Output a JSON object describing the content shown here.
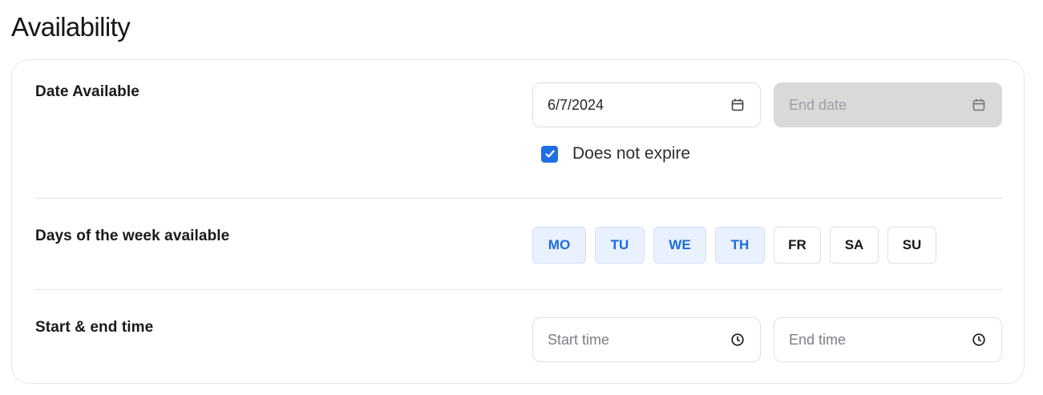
{
  "page": {
    "title": "Availability"
  },
  "date_row": {
    "label": "Date Available",
    "start_date": {
      "value": "6/7/2024",
      "icon": "calendar-icon"
    },
    "end_date": {
      "placeholder": "End date",
      "icon": "calendar-icon",
      "disabled": true
    },
    "does_not_expire": {
      "label": "Does not expire",
      "checked": true
    }
  },
  "days_row": {
    "label": "Days of the week available",
    "days": [
      {
        "label": "MO",
        "selected": true
      },
      {
        "label": "TU",
        "selected": true
      },
      {
        "label": "WE",
        "selected": true
      },
      {
        "label": "TH",
        "selected": true
      },
      {
        "label": "FR",
        "selected": false
      },
      {
        "label": "SA",
        "selected": false
      },
      {
        "label": "SU",
        "selected": false
      }
    ]
  },
  "time_row": {
    "label": "Start & end time",
    "start_time": {
      "placeholder": "Start time",
      "icon": "clock-icon"
    },
    "end_time": {
      "placeholder": "End time",
      "icon": "clock-icon"
    }
  },
  "colors": {
    "accent": "#1f6fe5",
    "selected_day_bg": "#e8f1fd",
    "selected_day_text": "#1d6be0",
    "disabled_field_bg": "#d9d9d9",
    "border": "#dcdfe3"
  }
}
